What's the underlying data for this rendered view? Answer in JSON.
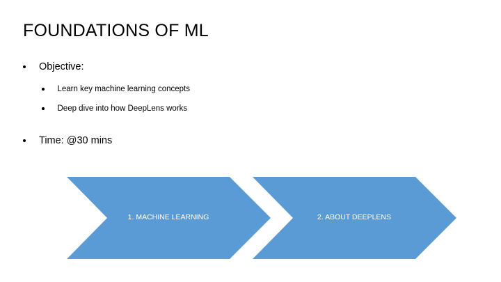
{
  "slide": {
    "title": "FOUNDATIONS OF ML",
    "bullets": [
      {
        "text": "Objective:"
      },
      {
        "text": "Learn key machine learning concepts"
      },
      {
        "text": "Deep dive into how DeepLens works"
      },
      {
        "text": "Time: @30 mins"
      }
    ]
  },
  "process": {
    "fill_color": "#5b9bd5",
    "steps": [
      {
        "label": "1. MACHINE LEARNING"
      },
      {
        "label": "2. ABOUT DEEPLENS"
      }
    ]
  }
}
